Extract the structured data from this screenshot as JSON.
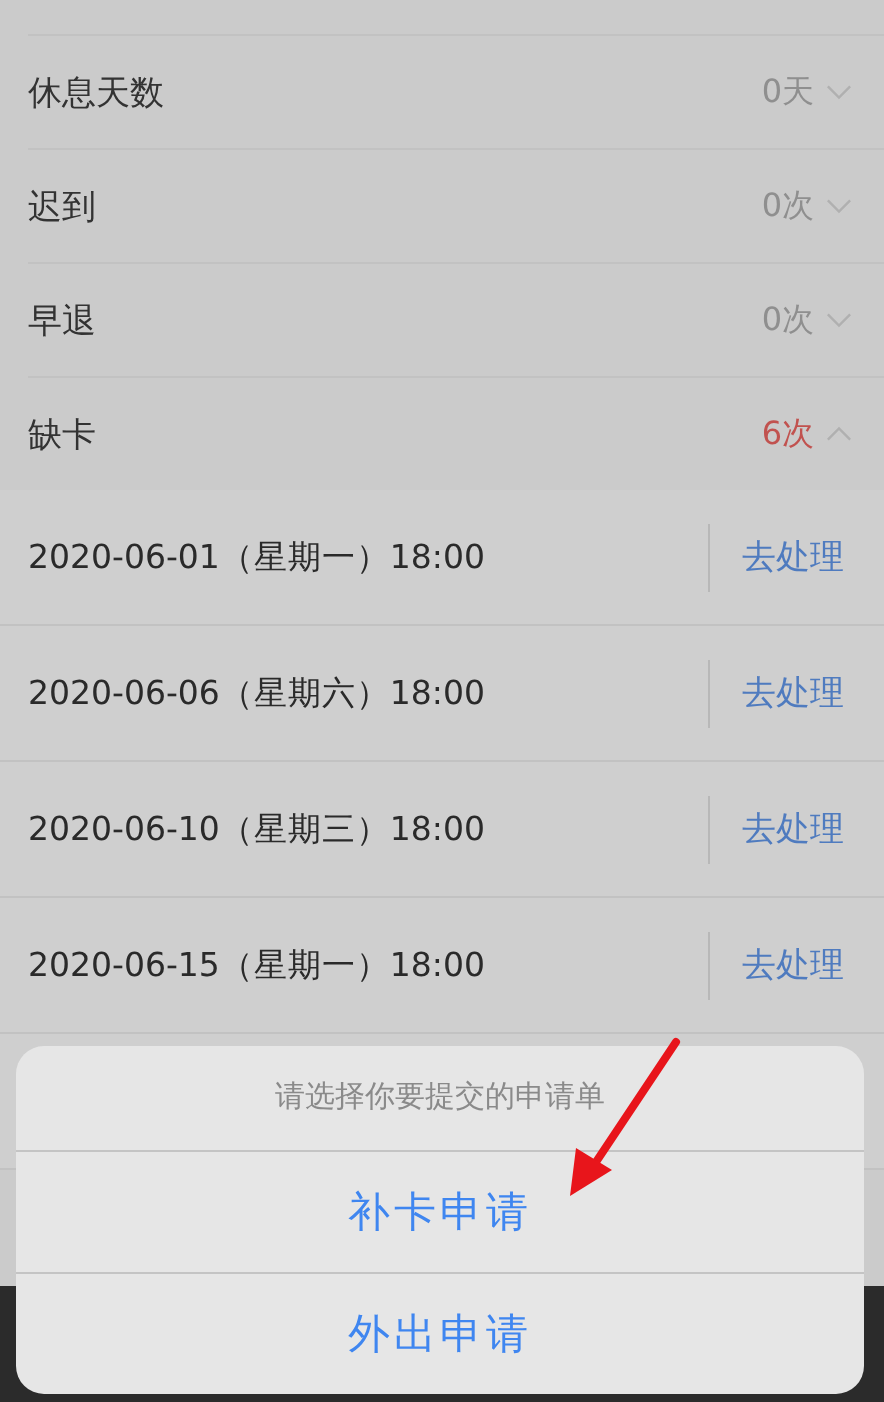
{
  "summary_rows": [
    {
      "label": "休息天数",
      "value": "0天",
      "expanded": false,
      "alert": false
    },
    {
      "label": "迟到",
      "value": "0次",
      "expanded": false,
      "alert": false
    },
    {
      "label": "早退",
      "value": "0次",
      "expanded": false,
      "alert": false
    },
    {
      "label": "缺卡",
      "value": "6次",
      "expanded": true,
      "alert": true
    }
  ],
  "records": [
    {
      "time": "2020-06-01（星期一）18:00",
      "action": "去处理"
    },
    {
      "time": "2020-06-06（星期六）18:00",
      "action": "去处理"
    },
    {
      "time": "2020-06-10（星期三）18:00",
      "action": "去处理"
    },
    {
      "time": "2020-06-15（星期一）18:00",
      "action": "去处理"
    }
  ],
  "action_sheet": {
    "title": "请选择你要提交的申请单",
    "options": [
      "补卡申请",
      "外出申请"
    ]
  }
}
